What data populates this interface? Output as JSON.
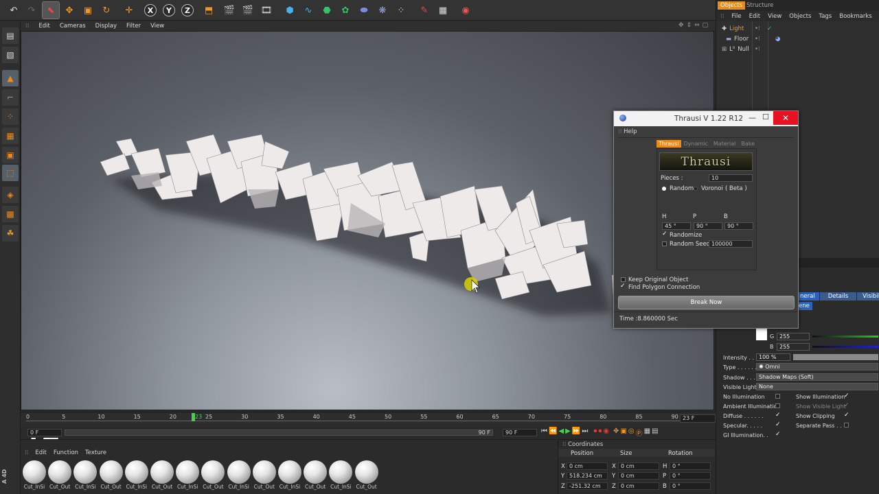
{
  "viewport_menu": [
    "Edit",
    "Cameras",
    "Display",
    "Filter",
    "View"
  ],
  "toolbar_axes": [
    "X",
    "Y",
    "Z"
  ],
  "object_manager": {
    "tabs": [
      "Objects",
      "Structure"
    ],
    "menu": [
      "File",
      "Edit",
      "View",
      "Objects",
      "Tags",
      "Bookmarks"
    ],
    "objects": [
      "Light",
      "Floor",
      "Null"
    ]
  },
  "thrausi": {
    "title": "Thrausi V 1.22 R12",
    "menu": "Help",
    "tabs": [
      "Thrausi",
      "Dynamic",
      "Material",
      "Bake"
    ],
    "logo": "Thrausi",
    "pieces_label": "Pieces :",
    "pieces_value": "10",
    "mode_random": "Random",
    "mode_voronoi": "Voronoi",
    "mode_beta": "( Beta )",
    "h_label": "H",
    "p_label": "P",
    "b_label": "B",
    "h_value": "45 °",
    "p_value": "90 °",
    "b_value": "90 °",
    "randomize": "Randomize",
    "random_seed_label": "Random Seed",
    "random_seed_value": "100000",
    "keep_original": "Keep Original Object",
    "find_polygon": "Find Polygon Connection",
    "break_button": "Break Now",
    "time": "Time :8.860000 Sec"
  },
  "attributes": {
    "tabs": [
      "neral",
      "Details",
      "Visibility"
    ],
    "scene_tab": "ene",
    "g_label": "G",
    "g_value": "255",
    "b_label": "B",
    "b_value": "255",
    "intensity_label": "Intensity . . .",
    "intensity_value": "100 %",
    "type_label": "Type . . . . . .",
    "type_value": "Omni",
    "shadow_label": "Shadow . . .",
    "shadow_value": "Shadow Maps (Soft)",
    "visible_light_label": "Visible Light",
    "visible_light_value": "None",
    "no_illum": "No Illumination",
    "ambient": "Ambient Illumination",
    "diffuse": "Diffuse . . . . . .",
    "specular": "Specular. . . . .",
    "gi": "GI Illumination. .",
    "show_illum": "Show Illumination",
    "show_visible": "Show Visible Light",
    "show_clipping": "Show Clipping",
    "separate_pass": "Separate Pass . ."
  },
  "timeline": {
    "ticks": [
      "0",
      "5",
      "10",
      "15",
      "20",
      "25",
      "30",
      "35",
      "40",
      "45",
      "50",
      "55",
      "60",
      "65",
      "70",
      "75",
      "80",
      "85",
      "90"
    ],
    "current": "23",
    "end_frame": "23 F",
    "start_field": "0 F",
    "range_end": "90 F",
    "max_field": "90 F"
  },
  "material_manager": {
    "menu": [
      "Edit",
      "Function",
      "Texture"
    ],
    "materials": [
      "Cut_InSi",
      "Cut_Out",
      "Cut_InSi",
      "Cut_Out",
      "Cut_InSi",
      "Cut_Out",
      "Cut_InSi",
      "Cut_Out",
      "Cut_InSi",
      "Cut_Out",
      "Cut_InSi",
      "Cut_Out",
      "Cut_InSi",
      "Cut_Out"
    ]
  },
  "coordinates": {
    "title": "Coordinates",
    "headers": [
      "Position",
      "Size",
      "Rotation"
    ],
    "pos": [
      "0 cm",
      "518.234 cm",
      "-251.32 cm"
    ],
    "size": [
      "0 cm",
      "0 cm",
      "0 cm"
    ],
    "rot": [
      "0 °",
      "0 °",
      "0 °"
    ],
    "axes": [
      "X",
      "Y",
      "Z"
    ],
    "rot_axes": [
      "H",
      "P",
      "B"
    ]
  },
  "watermark": "FZ",
  "side_logo": "A 4D"
}
